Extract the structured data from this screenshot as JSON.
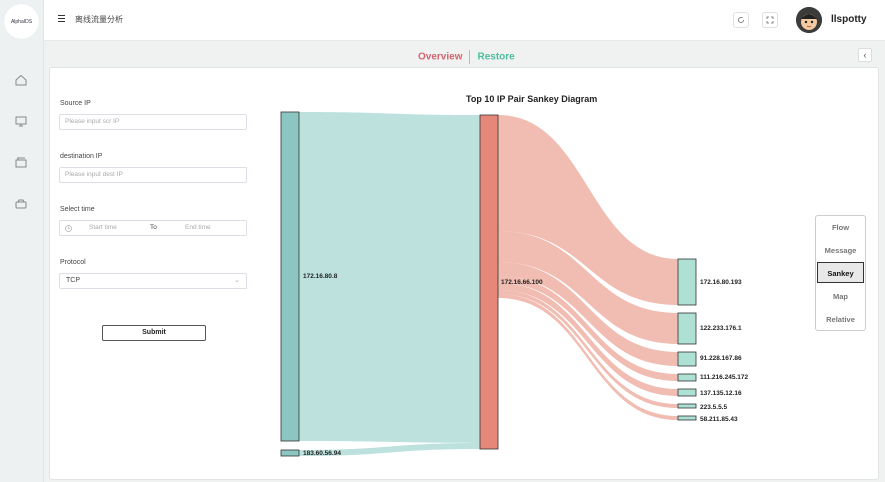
{
  "app": {
    "logo_text": "AlphaIDS",
    "page_title": "离线流量分析",
    "username": "llspotty"
  },
  "nav": {
    "items": [
      {
        "icon": "home-icon"
      },
      {
        "icon": "monitor-icon"
      },
      {
        "icon": "archive-icon"
      },
      {
        "icon": "vehicle-icon"
      }
    ]
  },
  "tabs": {
    "overview": "Overview",
    "restore": "Restore"
  },
  "form": {
    "source_label": "Source IP",
    "source_placeholder": "Please input scr IP",
    "dest_label": "destination IP",
    "dest_placeholder": "Please input dest IP",
    "time_label": "Select time",
    "start_placeholder": "Start time",
    "to_label": "To",
    "end_placeholder": "End time",
    "protocol_label": "Protocol",
    "protocol_value": "TCP",
    "submit_label": "Submit"
  },
  "chart_data": {
    "type": "sankey",
    "title": "Top 10 IP Pair Sankey Diagram",
    "sources": [
      "172.16.80.8",
      "183.60.56.94"
    ],
    "hub": "172.16.66.100",
    "targets": [
      "172.16.80.193",
      "122.233.176.1",
      "91.228.167.86",
      "111.216.245.172",
      "137.135.12.16",
      "223.5.5.5",
      "58.211.85.43"
    ],
    "colors": {
      "source": "#8bc6c2",
      "hub": "#e5887a",
      "target_fill": "#aee0d4",
      "link_in": "#b9e0dc",
      "link_out": "#efb5a8"
    }
  },
  "right_menu": {
    "items": [
      "Flow",
      "Message",
      "Sankey",
      "Map",
      "Relative"
    ],
    "active": "Sankey"
  }
}
